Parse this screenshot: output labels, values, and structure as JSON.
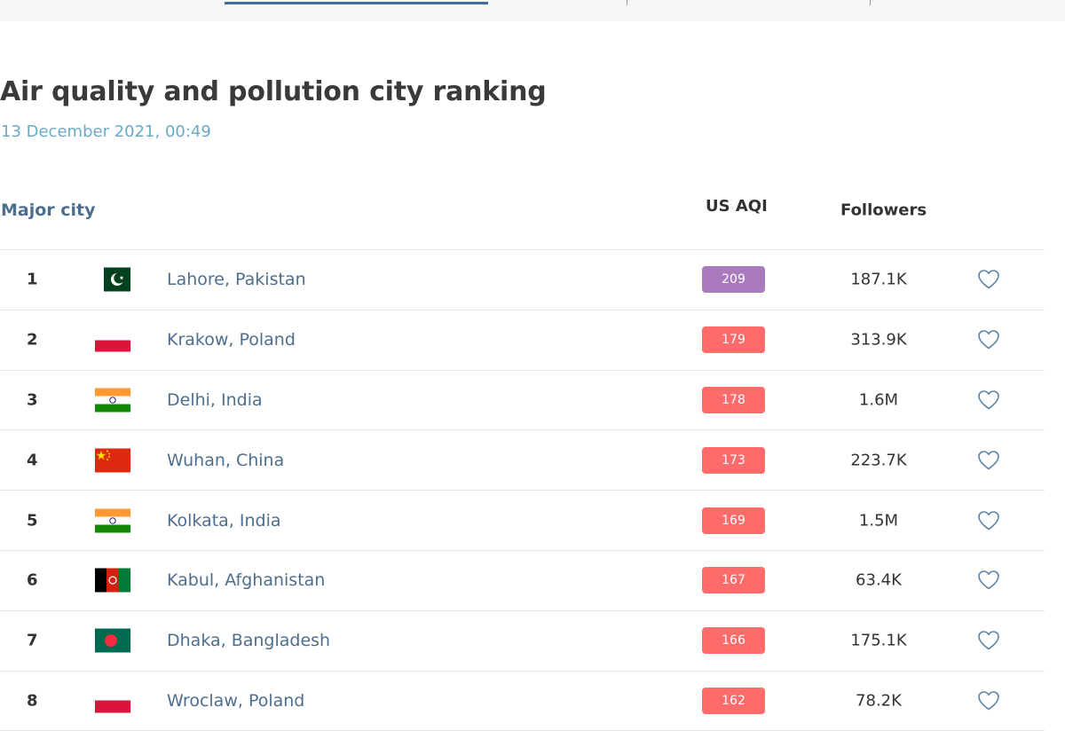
{
  "page": {
    "title": "Air quality and pollution city ranking",
    "timestamp": "13 December 2021, 00:49"
  },
  "table": {
    "headers": {
      "city": "Major city",
      "aqi": "US AQI",
      "followers": "Followers"
    },
    "rows": [
      {
        "rank": "1",
        "city": "Lahore, Pakistan",
        "flag": "pakistan-flag",
        "aqi": "209",
        "aqi_color": "#a97abc",
        "followers": "187.1K"
      },
      {
        "rank": "2",
        "city": "Krakow, Poland",
        "flag": "poland-flag",
        "aqi": "179",
        "aqi_color": "#fd6b6b",
        "followers": "313.9K"
      },
      {
        "rank": "3",
        "city": "Delhi, India",
        "flag": "india-flag",
        "aqi": "178",
        "aqi_color": "#fd6b6b",
        "followers": "1.6M"
      },
      {
        "rank": "4",
        "city": "Wuhan, China",
        "flag": "china-flag",
        "aqi": "173",
        "aqi_color": "#fd6b6b",
        "followers": "223.7K"
      },
      {
        "rank": "5",
        "city": "Kolkata, India",
        "flag": "india-flag",
        "aqi": "169",
        "aqi_color": "#fd6b6b",
        "followers": "1.5M"
      },
      {
        "rank": "6",
        "city": "Kabul, Afghanistan",
        "flag": "afghanistan-flag",
        "aqi": "167",
        "aqi_color": "#fd6b6b",
        "followers": "63.4K"
      },
      {
        "rank": "7",
        "city": "Dhaka, Bangladesh",
        "flag": "bangladesh-flag",
        "aqi": "166",
        "aqi_color": "#fd6b6b",
        "followers": "175.1K"
      },
      {
        "rank": "8",
        "city": "Wroclaw, Poland",
        "flag": "poland-flag",
        "aqi": "162",
        "aqi_color": "#fd6b6b",
        "followers": "78.2K"
      }
    ]
  },
  "icons": {
    "follow": "heart-outline-icon"
  },
  "colors": {
    "city_link": "#4e6e8e",
    "timestamp": "#6aaac6",
    "heart_stroke": "#5d83a6",
    "aqi_unhealthy": "#fd6b6b",
    "aqi_very_unhealthy": "#a97abc"
  }
}
